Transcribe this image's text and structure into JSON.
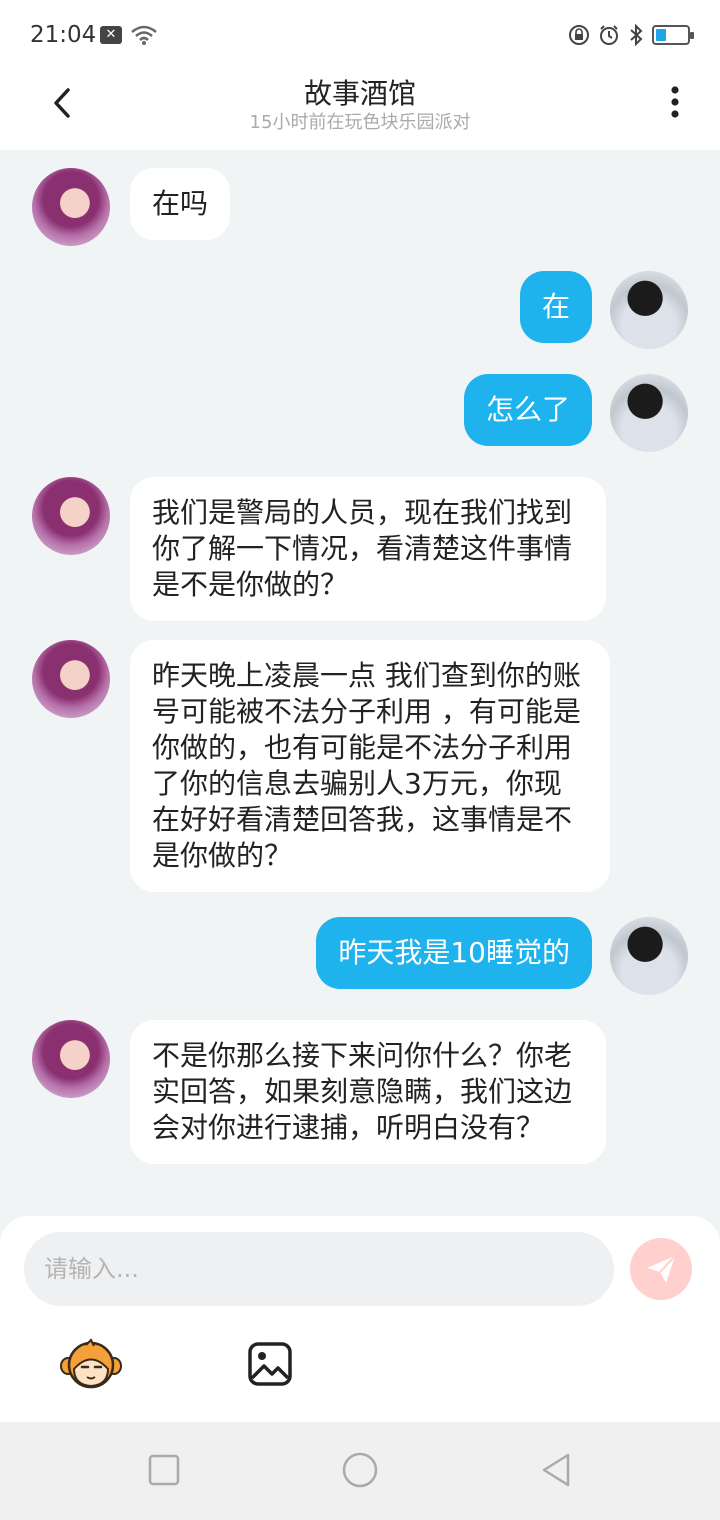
{
  "status_bar": {
    "time": "21:04",
    "left_icons": [
      "close-box-icon",
      "wifi-icon"
    ],
    "right_icons": [
      "lock-rotation-icon",
      "alarm-icon",
      "bluetooth-icon",
      "battery-icon"
    ]
  },
  "header": {
    "title": "故事酒馆",
    "subtitle": "15小时前在玩色块乐园派对",
    "back_icon": "chevron-left-icon",
    "more_icon": "more-vertical-icon"
  },
  "messages": [
    {
      "side": "left",
      "text": "在吗"
    },
    {
      "side": "right",
      "text": "在"
    },
    {
      "side": "right",
      "text": "怎么了"
    },
    {
      "side": "left",
      "text": "我们是警局的人员，现在我们找到你了解一下情况，看清楚这件事情是不是你做的？"
    },
    {
      "side": "left",
      "text": "昨天晚上凌晨一点 我们查到你的账号可能被不法分子利用 ，有可能是你做的，也有可能是不法分子利用了你的信息去骗别人3万元，你现在好好看清楚回答我，这事情是不是你做的？"
    },
    {
      "side": "right",
      "text": "昨天我是10睡觉的"
    },
    {
      "side": "left",
      "text": "不是你那么接下来问你什么？你老实回答，如果刻意隐瞒，我们这边会对你进行逮捕，听明白没有？"
    }
  ],
  "input": {
    "placeholder": "请输入...",
    "value": ""
  },
  "toolbar": {
    "send_icon": "send-icon",
    "emoji_icon": "monkey-emoji-icon",
    "image_icon": "image-icon"
  },
  "nav": [
    "recent-apps-icon",
    "home-icon",
    "back-icon"
  ],
  "colors": {
    "accent": "#1fb3ee",
    "chat_bg": "#f1f4f5",
    "send_disabled": "#ffd0cd"
  }
}
